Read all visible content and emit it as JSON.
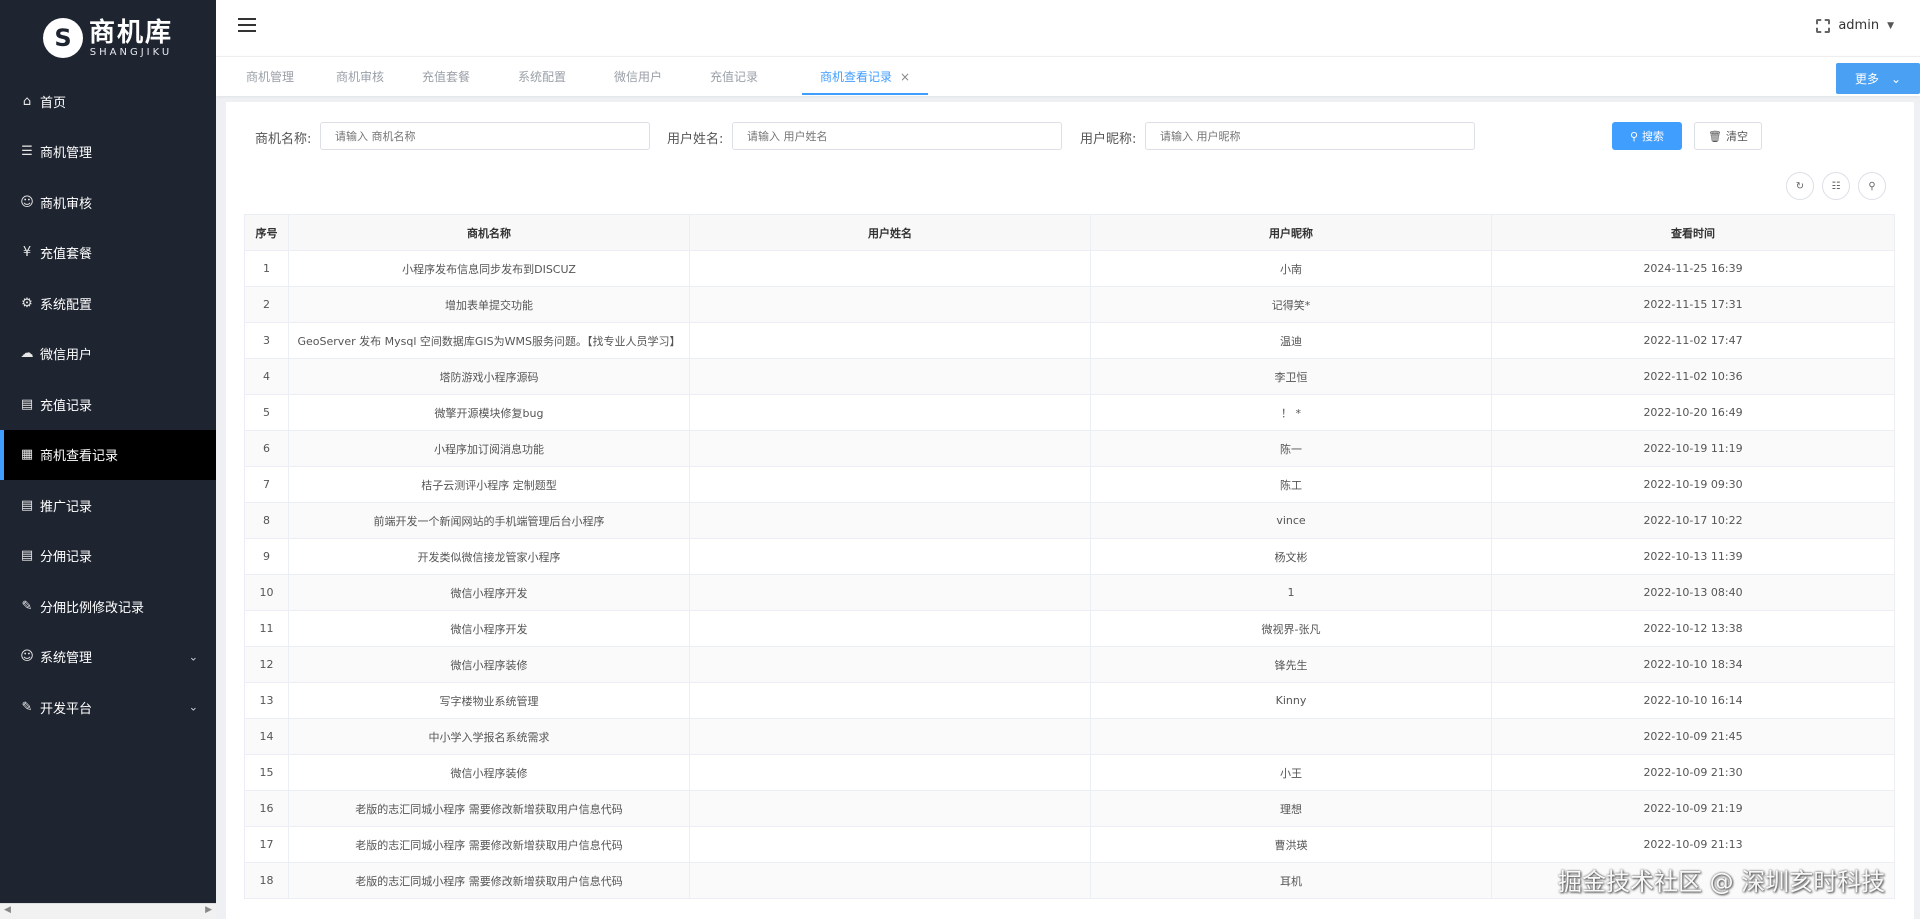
{
  "logo": {
    "mark": "S",
    "title": "商机库",
    "subtitle": "SHANGJIKU"
  },
  "sidebar": {
    "items": [
      {
        "label": "首页",
        "icon": "home-icon",
        "glyph": "⌂"
      },
      {
        "label": "商机管理",
        "icon": "list-icon",
        "glyph": "☰"
      },
      {
        "label": "商机审核",
        "icon": "user-check-icon",
        "glyph": "☺"
      },
      {
        "label": "充值套餐",
        "icon": "yen-icon",
        "glyph": "¥"
      },
      {
        "label": "系统配置",
        "icon": "gear-icon",
        "glyph": "⚙"
      },
      {
        "label": "微信用户",
        "icon": "wechat-icon",
        "glyph": "☁"
      },
      {
        "label": "充值记录",
        "icon": "document-icon",
        "glyph": "▤"
      },
      {
        "label": "商机查看记录",
        "icon": "calendar-icon",
        "glyph": "▦",
        "active": true
      },
      {
        "label": "推广记录",
        "icon": "document-icon",
        "glyph": "▤"
      },
      {
        "label": "分佣记录",
        "icon": "document-icon",
        "glyph": "▤"
      },
      {
        "label": "分佣比例修改记录",
        "icon": "edit-icon",
        "glyph": "✎"
      },
      {
        "label": "系统管理",
        "icon": "user-icon",
        "glyph": "☺",
        "expandable": true
      },
      {
        "label": "开发平台",
        "icon": "edit-icon",
        "glyph": "✎",
        "expandable": true
      }
    ]
  },
  "header": {
    "user": "admin"
  },
  "tabs": [
    {
      "label": "商机管理"
    },
    {
      "label": "商机审核"
    },
    {
      "label": "充值套餐"
    },
    {
      "label": "系统配置"
    },
    {
      "label": "微信用户"
    },
    {
      "label": "充值记录"
    },
    {
      "label": "商机查看记录",
      "active": true
    }
  ],
  "more_label": "更多",
  "search": {
    "fields": [
      {
        "label": "商机名称:",
        "placeholder": "请输入 商机名称"
      },
      {
        "label": "用户姓名:",
        "placeholder": "请输入 用户姓名"
      },
      {
        "label": "用户昵称:",
        "placeholder": "请输入 用户昵称"
      }
    ],
    "search_label": "搜索",
    "clear_label": "清空"
  },
  "table": {
    "columns": [
      "序号",
      "商机名称",
      "用户姓名",
      "用户昵称",
      "查看时间"
    ],
    "rows": [
      [
        "1",
        "小程序发布信息同步发布到DISCUZ",
        "",
        "小南",
        "2024-11-25 16:39"
      ],
      [
        "2",
        "增加表单提交功能",
        "",
        "记得笑*",
        "2022-11-15 17:31"
      ],
      [
        "3",
        "GeoServer 发布 Mysql 空间数据库GIS为WMS服务问题。【找专业人员学习】",
        "",
        "温迪",
        "2022-11-02 17:47"
      ],
      [
        "4",
        "塔防游戏小程序源码",
        "",
        "李卫恒",
        "2022-11-02 10:36"
      ],
      [
        "5",
        "微擎开源模块修复bug",
        "",
        "！ *",
        "2022-10-20 16:49"
      ],
      [
        "6",
        "小程序加订阅消息功能",
        "",
        "陈一",
        "2022-10-19 11:19"
      ],
      [
        "7",
        "桔子云测评小程序 定制题型",
        "",
        "陈工",
        "2022-10-19 09:30"
      ],
      [
        "8",
        "前端开发一个新闻网站的手机端管理后台小程序",
        "",
        "vince",
        "2022-10-17 10:22"
      ],
      [
        "9",
        "开发类似微信接龙管家小程序",
        "",
        "杨文彬",
        "2022-10-13 11:39"
      ],
      [
        "10",
        "微信小程序开发",
        "",
        "1",
        "2022-10-13 08:40"
      ],
      [
        "11",
        "微信小程序开发",
        "",
        "微视界-张凡",
        "2022-10-12 13:38"
      ],
      [
        "12",
        "微信小程序装修",
        "",
        "锋先生",
        "2022-10-10 18:34"
      ],
      [
        "13",
        "写字楼物业系统管理",
        "",
        "Kinny",
        "2022-10-10 16:14"
      ],
      [
        "14",
        "中小学入学报名系统需求",
        "",
        "",
        "2022-10-09 21:45"
      ],
      [
        "15",
        "微信小程序装修",
        "",
        "小王",
        "2022-10-09 21:30"
      ],
      [
        "16",
        "老版的志汇同城小程序 需要修改新增获取用户信息代码",
        "",
        "理想",
        "2022-10-09 21:19"
      ],
      [
        "17",
        "老版的志汇同城小程序 需要修改新增获取用户信息代码",
        "",
        "曹洪瑛",
        "2022-10-09 21:13"
      ],
      [
        "18",
        "老版的志汇同城小程序 需要修改新增获取用户信息代码",
        "",
        "耳机",
        ""
      ]
    ]
  },
  "watermark": "掘金技术社区 @ 深圳亥时科技",
  "colors": {
    "sidebar_bg": "#1f2530",
    "accent": "#409eff",
    "active_bg": "#000000"
  }
}
